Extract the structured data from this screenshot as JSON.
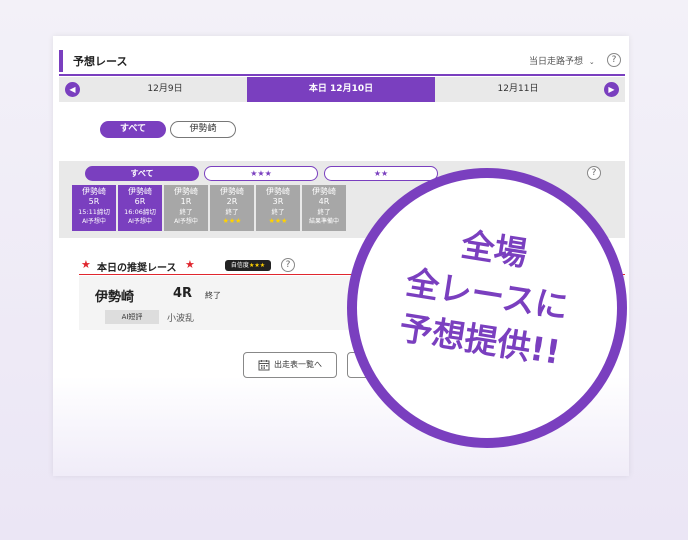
{
  "header": {
    "title": "予想レース",
    "selector": "当日走路予想",
    "help": "?"
  },
  "dates": {
    "prev": "12月9日",
    "today": "本日 12月10日",
    "next": "12月11日"
  },
  "venue_tabs": [
    "すべて",
    "伊勢崎"
  ],
  "filters": {
    "tabs": [
      "すべて",
      "★★★",
      "★★"
    ],
    "help": "?"
  },
  "races": [
    {
      "venue": "伊勢崎",
      "race": "5R",
      "status": "15:11締切",
      "note": "AI予想中",
      "stars": ""
    },
    {
      "venue": "伊勢崎",
      "race": "6R",
      "status": "16:06締切",
      "note": "AI予想中",
      "stars": ""
    },
    {
      "venue": "伊勢崎",
      "race": "1R",
      "status": "終了",
      "note": "AI予想中",
      "stars": ""
    },
    {
      "venue": "伊勢崎",
      "race": "2R",
      "status": "終了",
      "note": "",
      "stars": "★★★"
    },
    {
      "venue": "伊勢崎",
      "race": "3R",
      "status": "終了",
      "note": "",
      "stars": "★★★"
    },
    {
      "venue": "伊勢崎",
      "race": "4R",
      "status": "終了",
      "note": "結果準備中",
      "stars": ""
    }
  ],
  "recommend": {
    "star": "★",
    "title": "本日の推奨レース",
    "badge_label": "自信度",
    "badge_stars": "★★★",
    "help": "?",
    "venue": "伊勢崎",
    "race": "4R",
    "status": "終了",
    "tag": "AI短評",
    "short": "小波乱"
  },
  "buttons": {
    "schedule": "出走表一覧へ"
  },
  "promo": {
    "line1": "全場",
    "line2": "全レースに",
    "line3": "予想提供!!"
  },
  "colors": {
    "accent": "#7a3fbf",
    "red": "#e0262e",
    "star": "#ffd200"
  }
}
